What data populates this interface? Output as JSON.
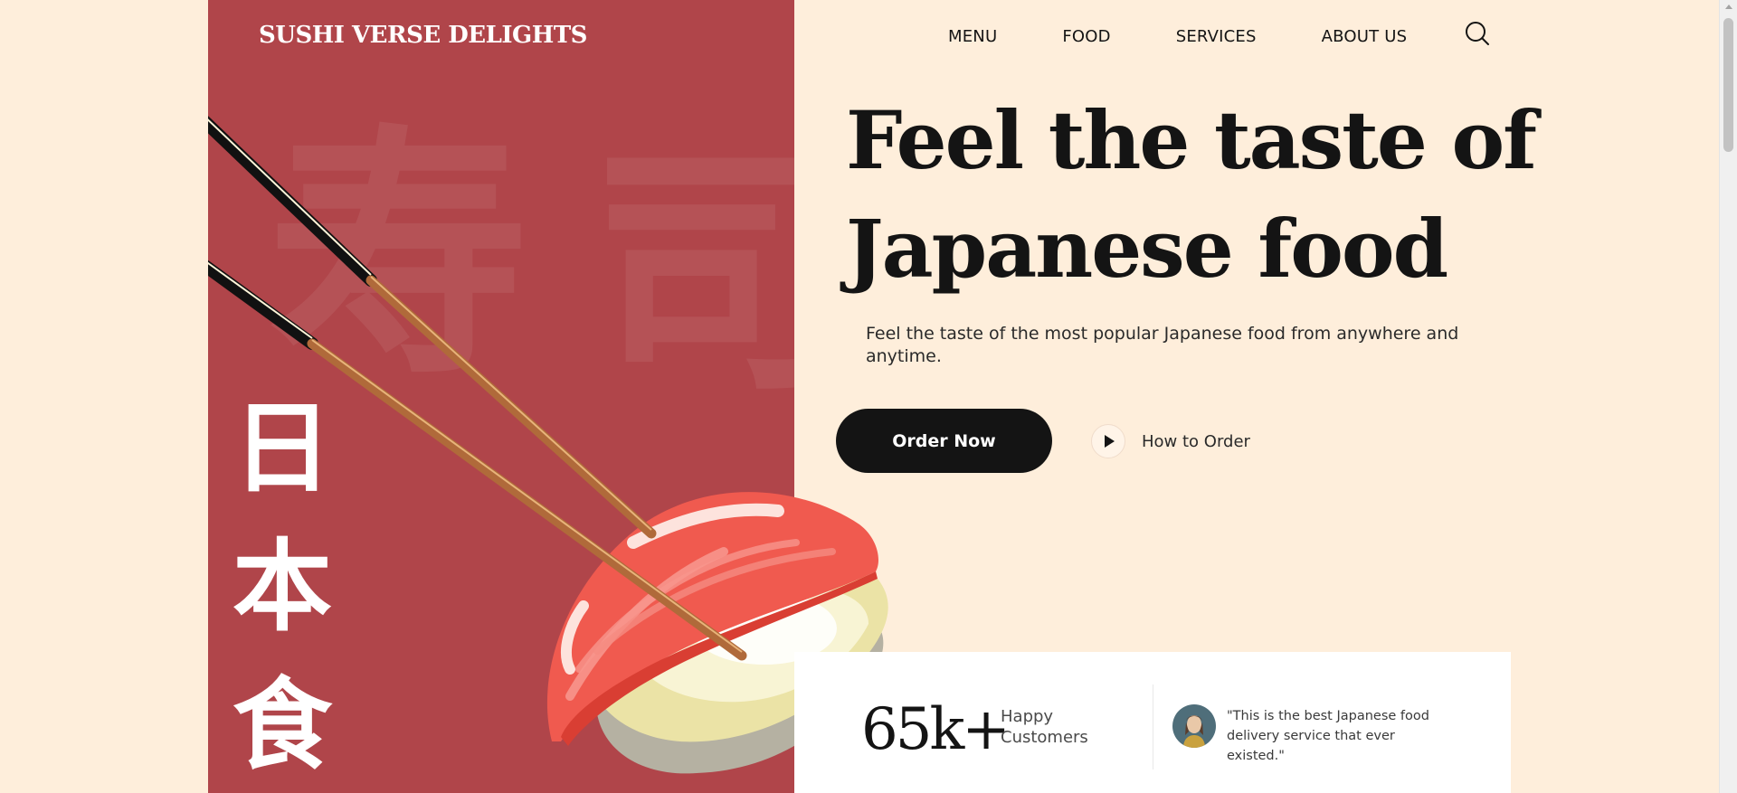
{
  "brand": {
    "name": "SUSHI VERSE DELIGHTS"
  },
  "nav": {
    "items": [
      "MENU",
      "FOOD",
      "SERVICES",
      "ABOUT US"
    ],
    "search_icon": "search-icon"
  },
  "hero": {
    "headline_line1": "Feel the taste of",
    "headline_line2": "Japanese food",
    "subtitle": "Feel the taste of the most popular Japanese food from anywhere and anytime.",
    "order_button": "Order Now",
    "how_to_order": "How to Order",
    "vertical_kanji": [
      "日",
      "本",
      "食"
    ],
    "background_kanji": [
      "寿",
      "司"
    ]
  },
  "stats": {
    "number": "65k+",
    "label": "Happy Customers",
    "quote": "\"This is the best Japanese food delivery service that ever existed.\""
  },
  "colors": {
    "page_bg": "#feeedb",
    "hero_red": "#b0454a",
    "button_dark": "#141414",
    "tuna": "#f05a4f",
    "rice": "#f3efc8"
  }
}
